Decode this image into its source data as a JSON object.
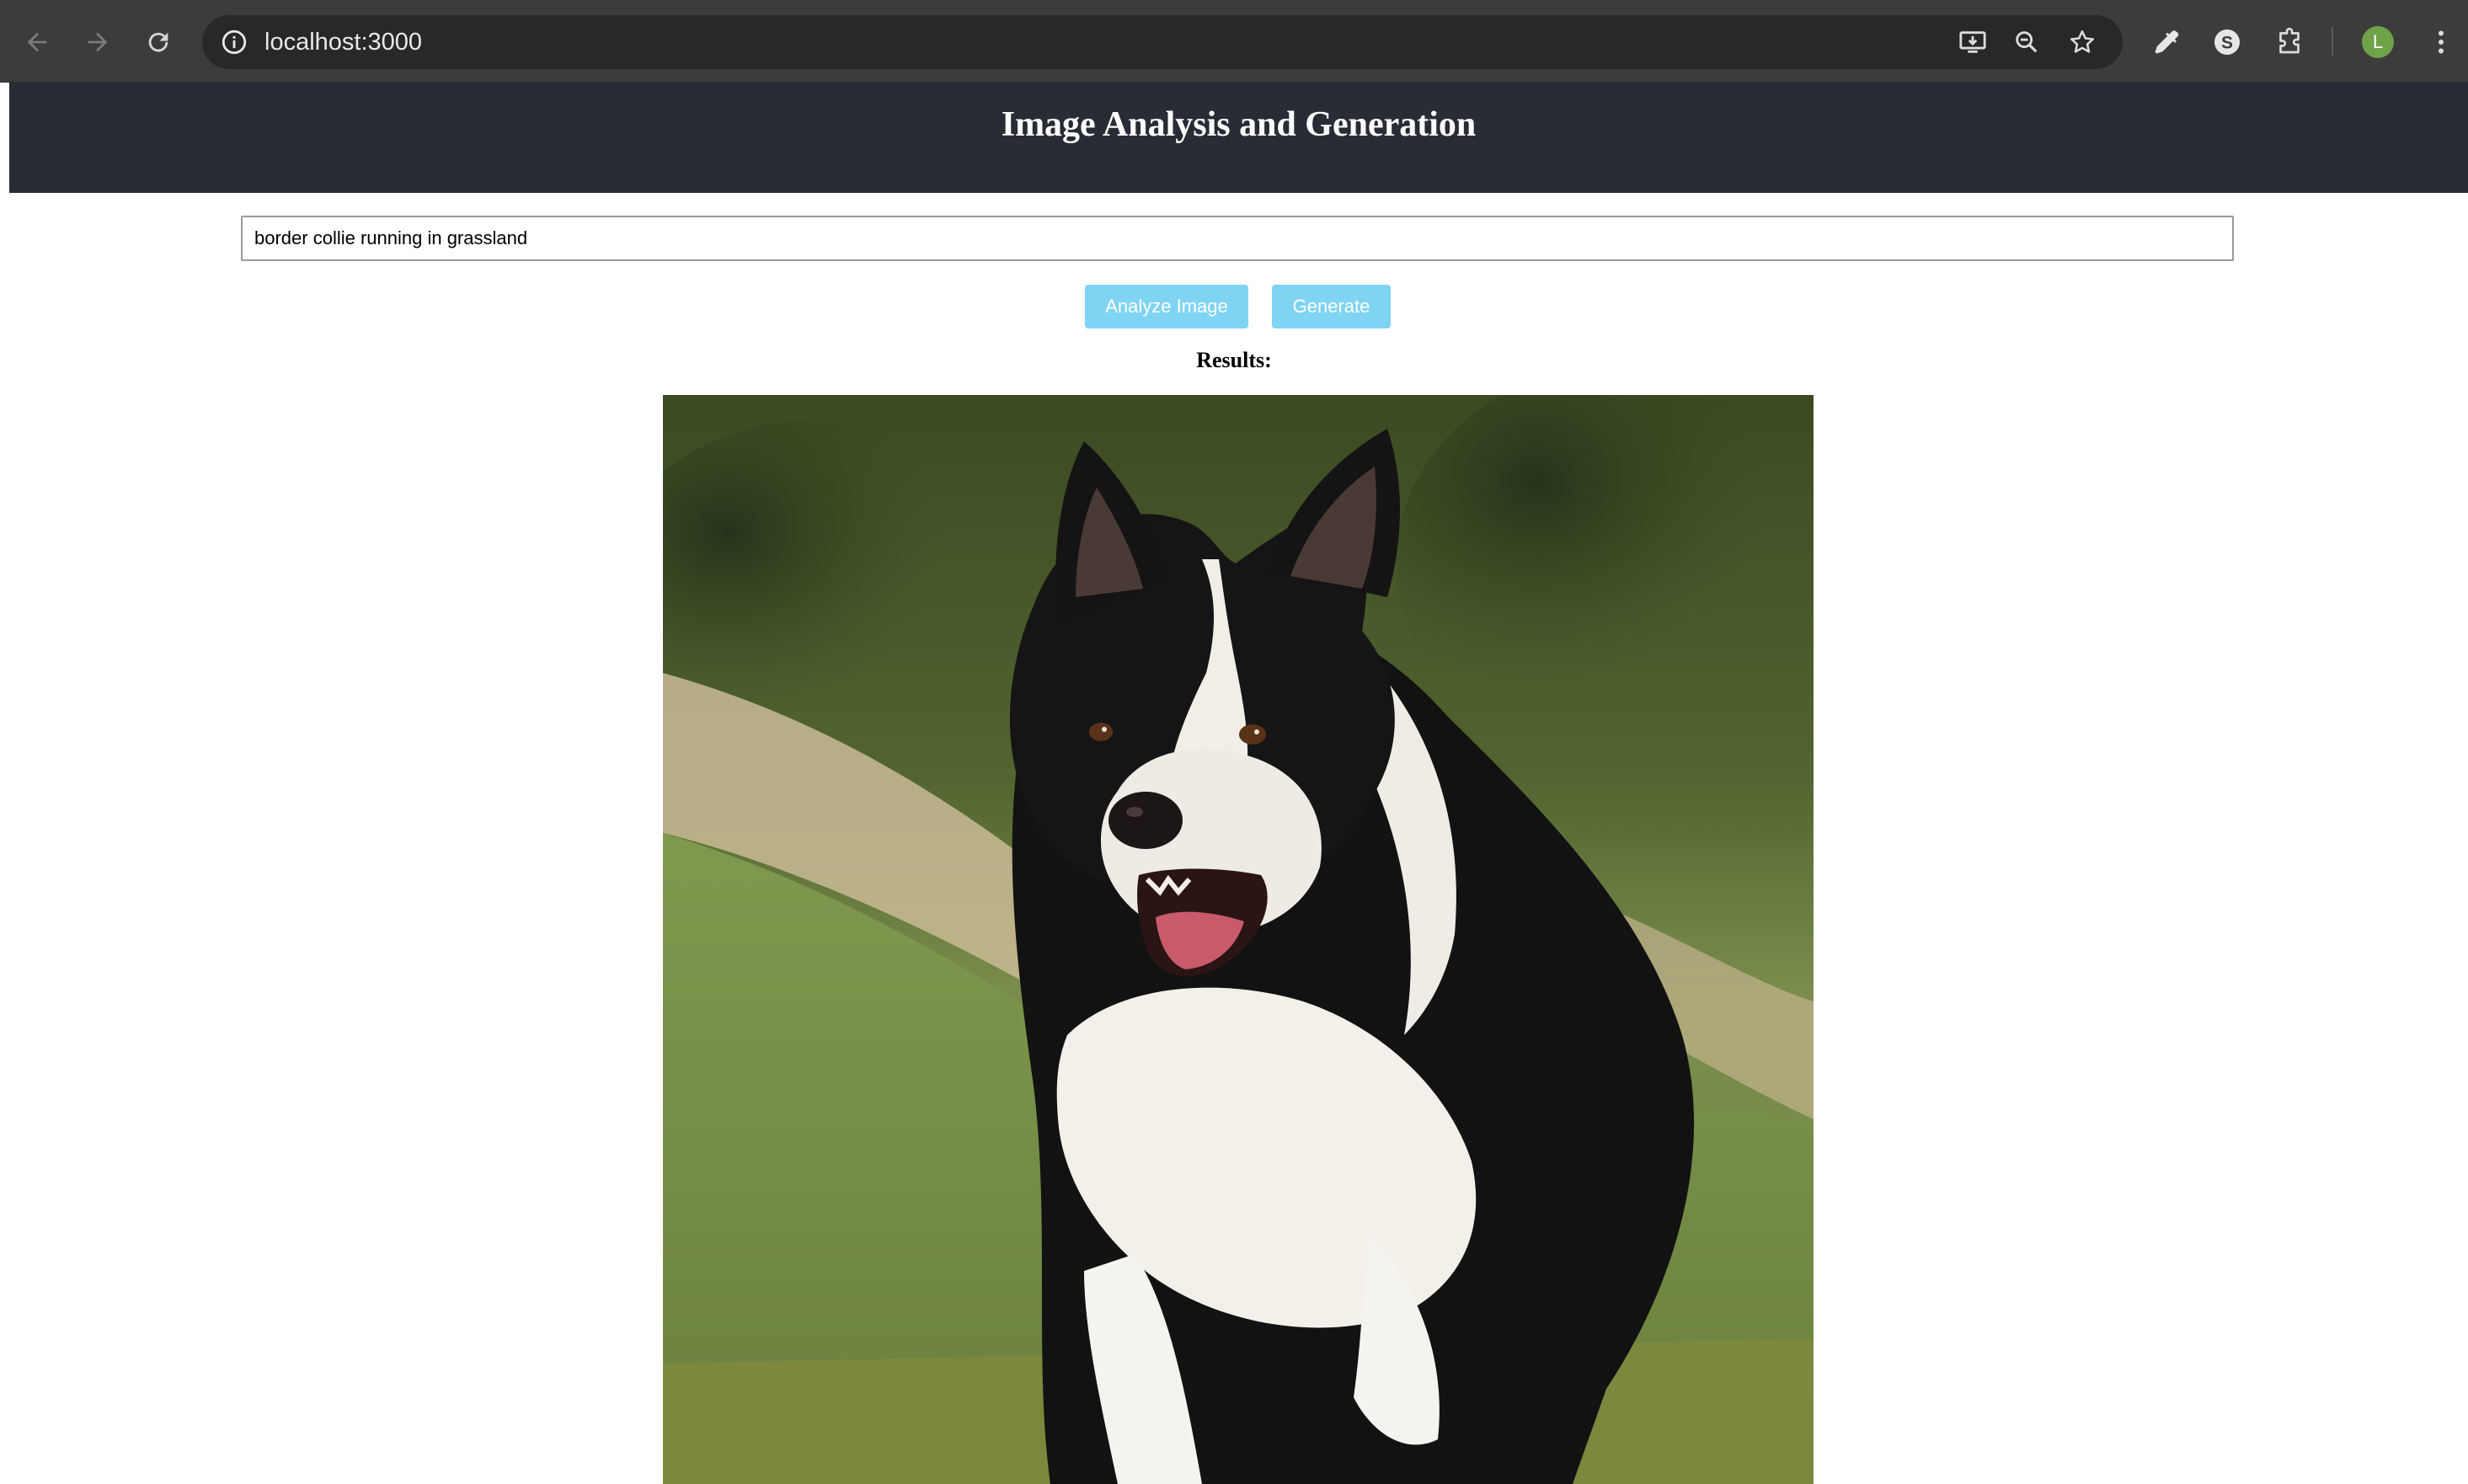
{
  "browser": {
    "url": "localhost:3000",
    "profile_initial": "L",
    "icons": [
      "back-icon",
      "forward-icon",
      "reload-icon",
      "site-info-icon",
      "install-app-icon",
      "zoom-icon",
      "bookmark-star-icon",
      "eyedropper-icon",
      "extension-s-icon",
      "extensions-puzzle-icon",
      "more-menu-icon"
    ]
  },
  "app": {
    "title": "Image Analysis and Generation",
    "prompt_value": "border collie running in grassland",
    "analyze_label": "Analyze Image",
    "generate_label": "Generate",
    "results_label": "Results:",
    "image_alt": "border collie running in grassland"
  },
  "colors": {
    "header_bg": "#282c34",
    "button_bg": "#7fd4f3",
    "chrome_bg": "#3c3c3c"
  }
}
